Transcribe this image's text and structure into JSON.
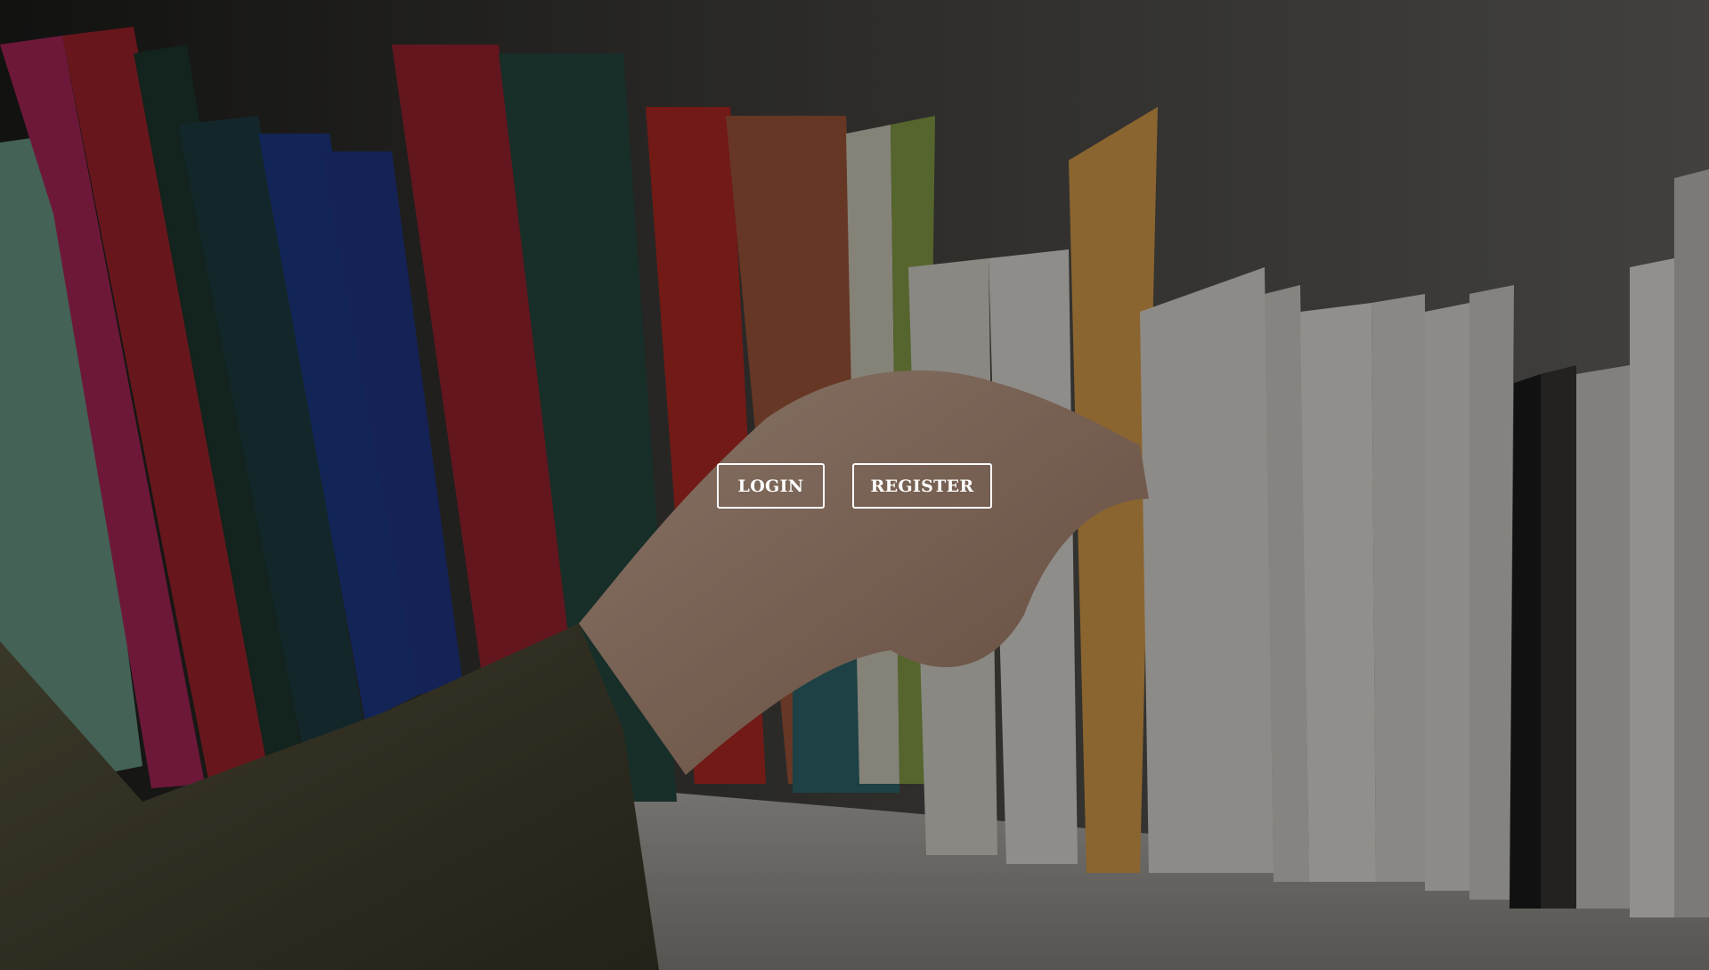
{
  "auth": {
    "login_label": "LOGIN",
    "register_label": "REGISTER"
  },
  "background": {
    "description_icon": "bookshelf-photo"
  },
  "colors": {
    "button_border": "#ffffff",
    "button_text": "#ffffff",
    "overlay": "rgba(0,0,0,0.38)"
  }
}
